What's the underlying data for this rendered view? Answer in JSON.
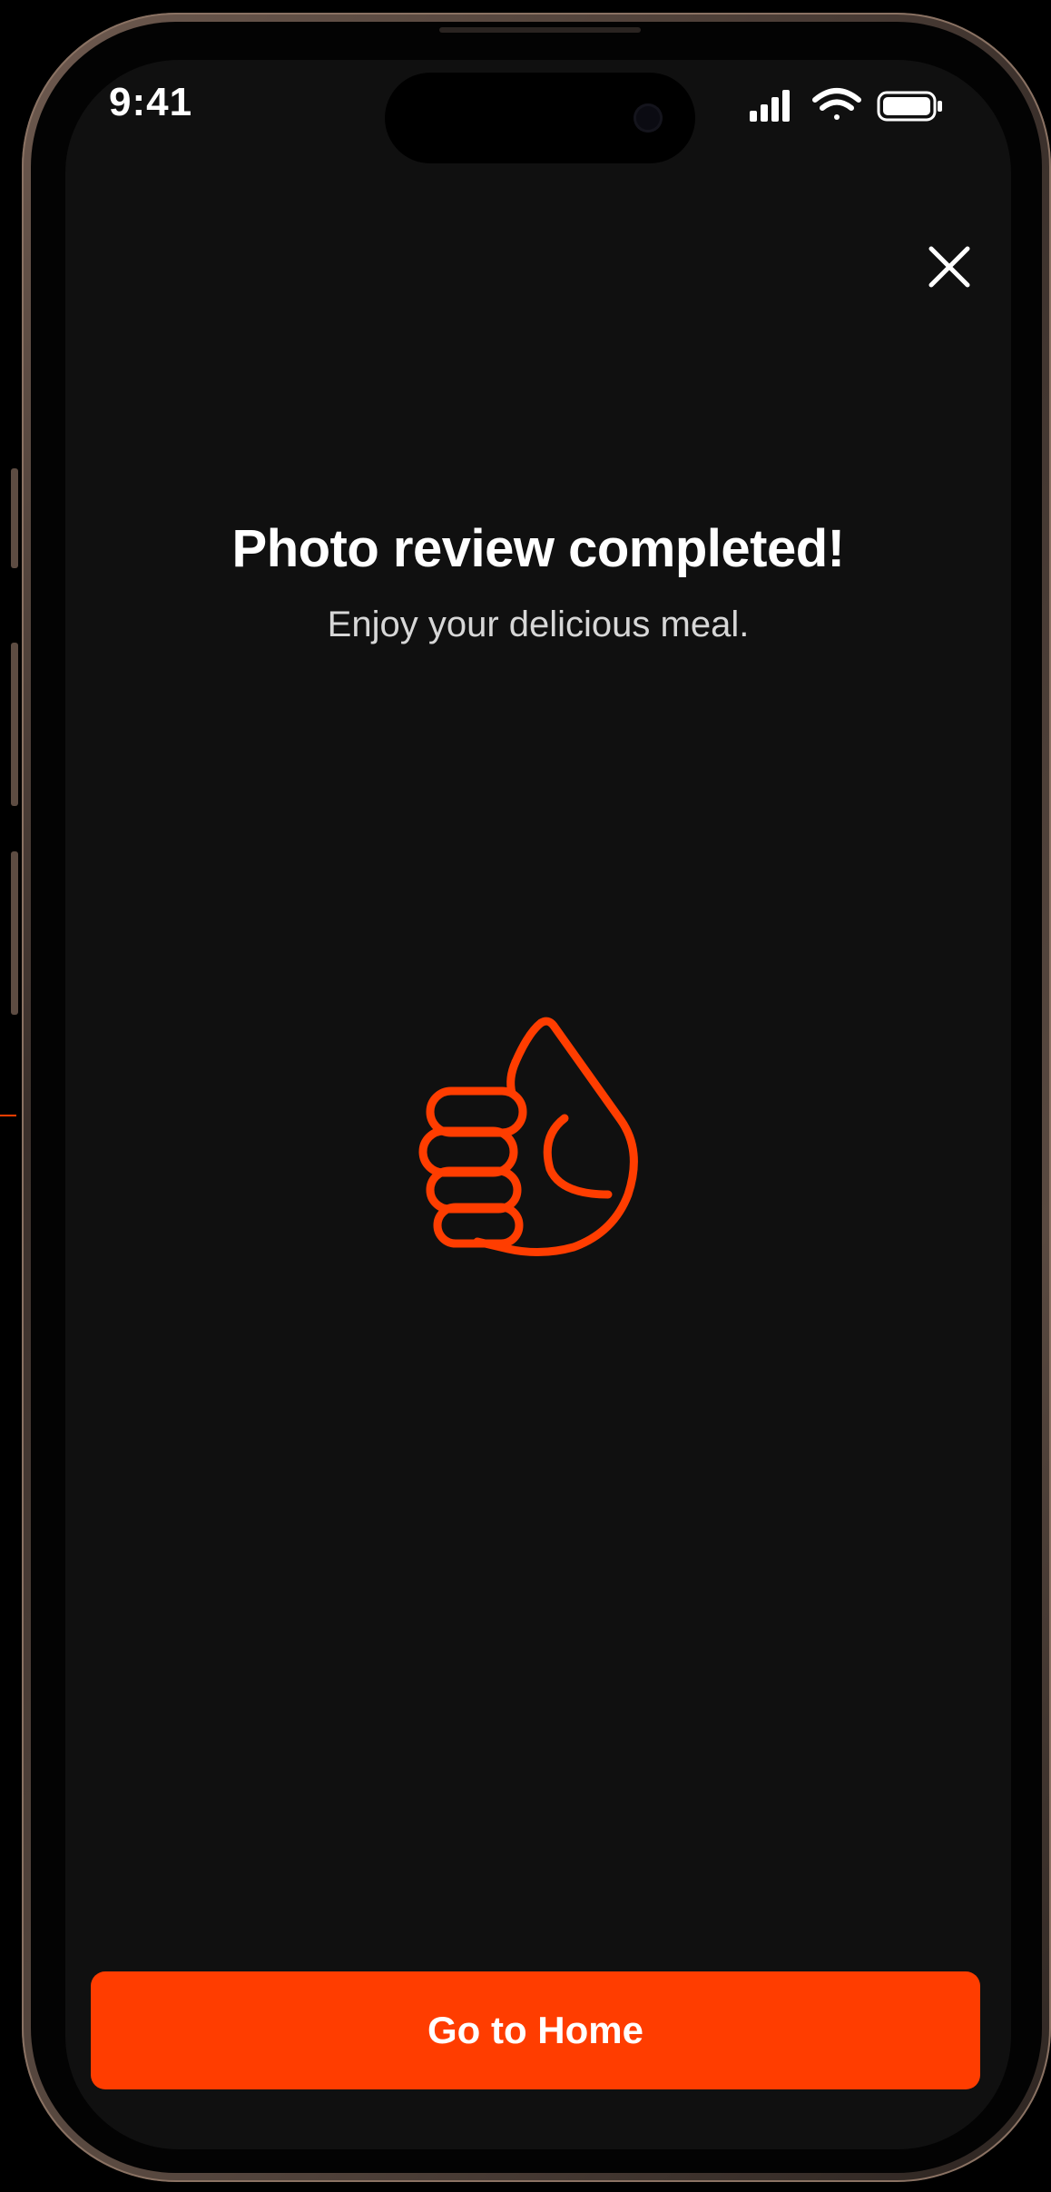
{
  "status_bar": {
    "time": "9:41",
    "icons": [
      "signal-icon",
      "wifi-icon",
      "battery-icon"
    ]
  },
  "header": {
    "close_icon": "close-icon"
  },
  "main": {
    "title": "Photo review completed!",
    "subtitle": "Enjoy your delicious meal.",
    "illustration": "thumbs-up-icon"
  },
  "footer": {
    "button_label": "Go to Home"
  },
  "colors": {
    "accent": "#ff3d00",
    "background": "#101010",
    "text": "#ffffff"
  }
}
